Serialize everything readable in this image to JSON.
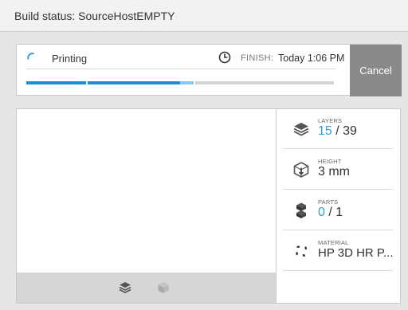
{
  "title": "Build status: SourceHostEMPTY",
  "status": {
    "label": "Printing",
    "finish_label": "FINISH:",
    "finish_time": "Today 1:06 PM",
    "cancel_label": "Cancel",
    "progress": [
      {
        "state": "done",
        "fraction": 0.2
      },
      {
        "state": "done",
        "fraction": 0.3
      },
      {
        "state": "active",
        "fraction": 0.05
      },
      {
        "state": "pending",
        "fraction": 0.45
      }
    ]
  },
  "preview": {
    "tiny_text": "··· ·· ··· ·· ···",
    "toolbar": [
      "layers-view-icon",
      "cube-view-icon"
    ]
  },
  "info": {
    "layers": {
      "label": "LAYERS",
      "current": "15",
      "separator": "/",
      "total": "39"
    },
    "height": {
      "label": "HEIGHT",
      "value": "3 mm"
    },
    "parts": {
      "label": "PARTS",
      "current": "0",
      "separator": "/",
      "total": "1"
    },
    "material": {
      "label": "MATERIAL",
      "value": "HP 3D HR P..."
    }
  },
  "colors": {
    "accent": "#2a9fd8",
    "progress_done": "#1e8fd0",
    "progress_active": "#8cc8ea",
    "progress_pending": "#d3d3d3",
    "cancel_bg": "#8a8a8a"
  }
}
